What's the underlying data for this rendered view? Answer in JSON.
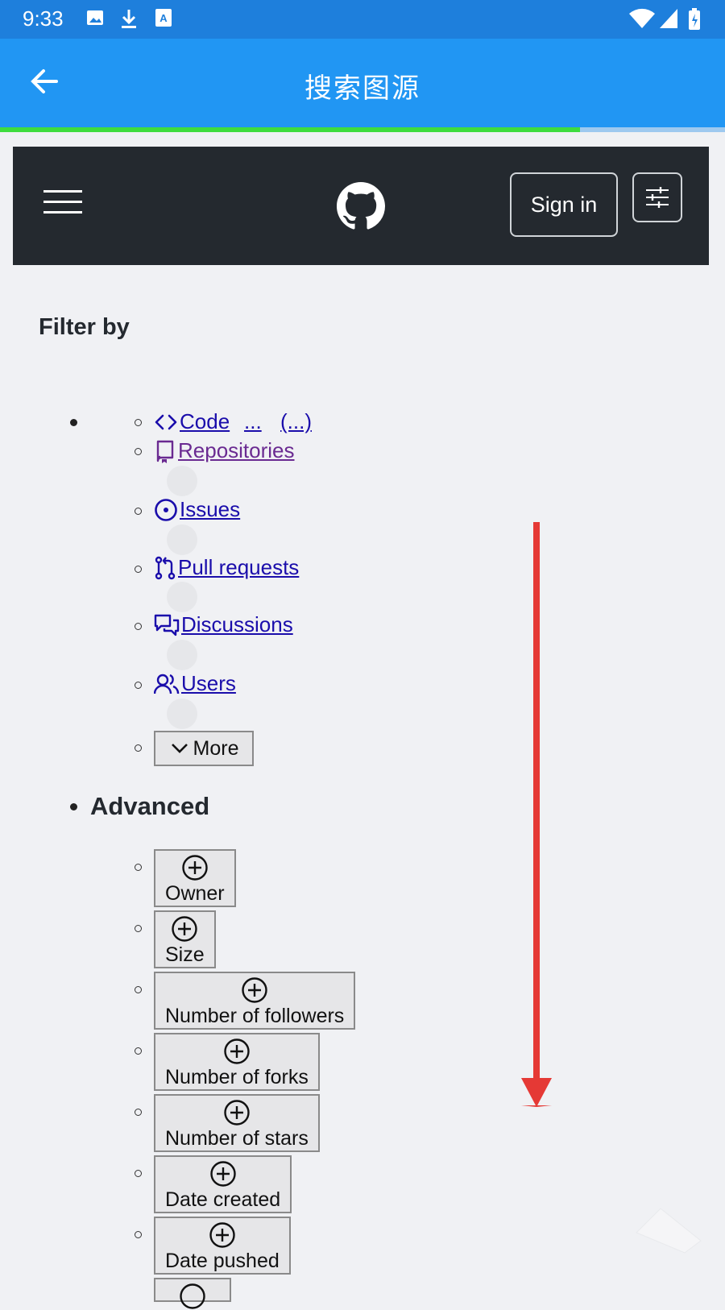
{
  "status_bar": {
    "time": "9:33"
  },
  "app_bar": {
    "title": "搜索图源",
    "progress": 0.8
  },
  "github_header": {
    "sign_in_label": "Sign in"
  },
  "filter": {
    "title": "Filter by",
    "items": [
      {
        "label": "Code",
        "extra1": "...",
        "extra2": "(...)",
        "icon": "code-icon"
      },
      {
        "label": "Repositories",
        "icon": "repo-icon"
      },
      {
        "label": "Issues",
        "icon": "issue-icon"
      },
      {
        "label": "Pull requests",
        "icon": "pull-request-icon"
      },
      {
        "label": "Discussions",
        "icon": "discussion-icon"
      },
      {
        "label": "Users",
        "icon": "people-icon"
      }
    ],
    "more_label": "More"
  },
  "advanced": {
    "title": "Advanced",
    "qualifiers": [
      "Owner",
      "Size",
      "Number of followers",
      "Number of forks",
      "Number of stars",
      "Date created",
      "Date pushed"
    ]
  },
  "colors": {
    "status_bar": "#1e7fdc",
    "app_bar": "#2196f3",
    "progress": "#3fdc3f",
    "link": "#1a0dab",
    "link_visited": "#6a2a91",
    "gh_header": "#24292f",
    "arrow": "#e53935"
  }
}
